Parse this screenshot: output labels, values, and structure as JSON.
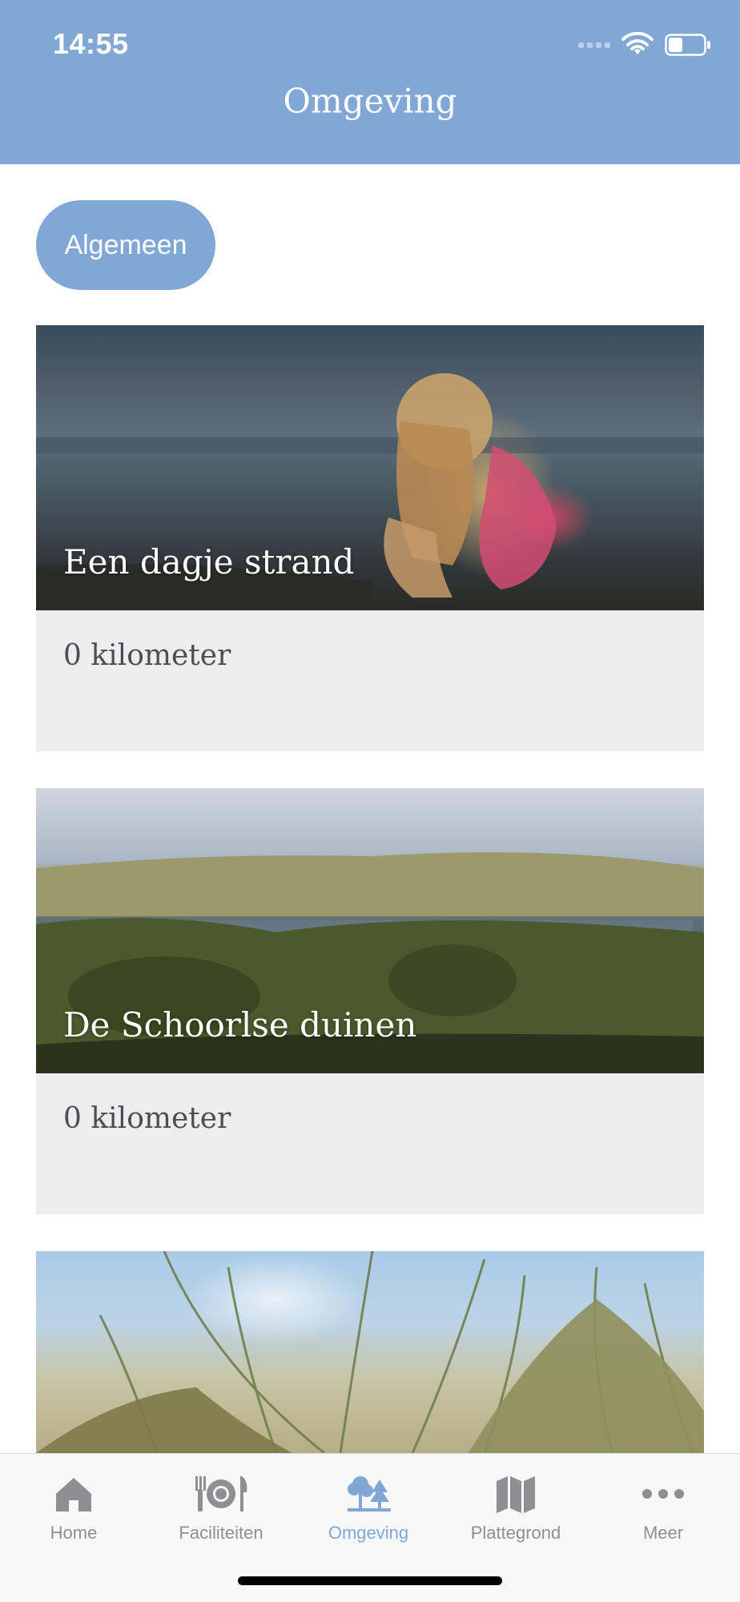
{
  "status_bar": {
    "time": "14:55"
  },
  "header": {
    "title": "Omgeving"
  },
  "category_pill": {
    "label": "Algemeen"
  },
  "cards": [
    {
      "title": "Een dagje strand",
      "distance": "0 kilometer"
    },
    {
      "title": "De Schoorlse duinen",
      "distance": "0 kilometer"
    },
    {
      "title": "",
      "distance": ""
    }
  ],
  "tabbar": {
    "items": [
      {
        "label": "Home",
        "icon": "home-icon"
      },
      {
        "label": "Faciliteiten",
        "icon": "utensils-icon"
      },
      {
        "label": "Omgeving",
        "icon": "trees-icon"
      },
      {
        "label": "Plattegrond",
        "icon": "map-icon"
      },
      {
        "label": "Meer",
        "icon": "more-icon"
      }
    ],
    "active_index": 2,
    "active_color": "#80a7d6",
    "inactive_color": "#8e8e93"
  },
  "colors": {
    "header_bg": "#80a7d6",
    "card_info_bg": "#ededed"
  }
}
